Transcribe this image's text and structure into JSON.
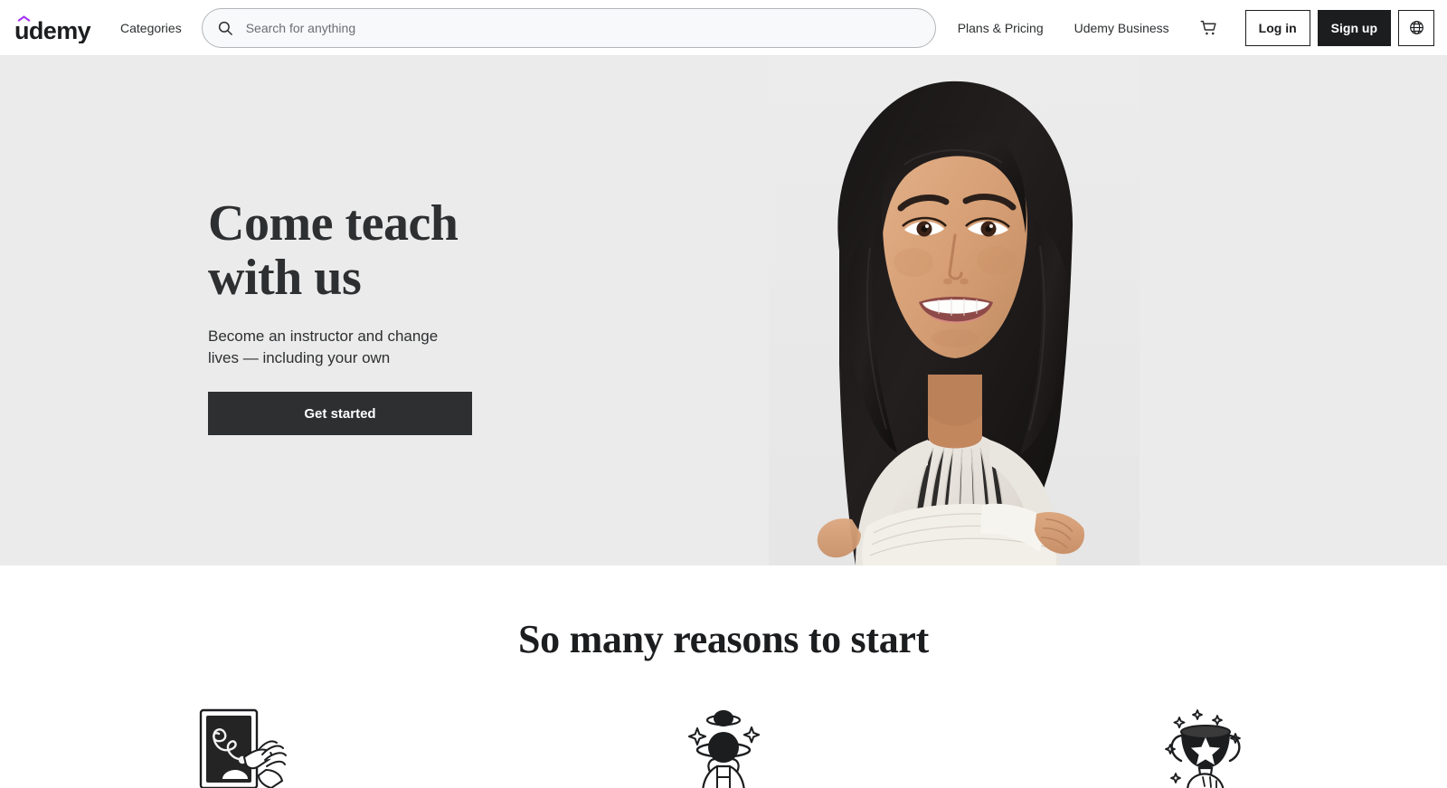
{
  "brand": {
    "logo_text": "udemy",
    "logo_accent_color": "#a435f0",
    "logo_text_color": "#1c1d1f"
  },
  "header": {
    "categories_label": "Categories",
    "search": {
      "placeholder": "Search for anything",
      "value": "",
      "icon": "search-icon"
    },
    "plans_pricing_label": "Plans & Pricing",
    "udemy_business_label": "Udemy Business",
    "cart_icon": "shopping-cart-icon",
    "login_label": "Log in",
    "signup_label": "Sign up",
    "language_icon": "globe-icon"
  },
  "hero": {
    "title_line1": "Come teach",
    "title_line2": "with us",
    "subtitle": "Become an instructor and change lives — including your own",
    "cta_label": "Get started",
    "background_color": "#ebebeb",
    "image_alt": "smiling-instructor-portrait"
  },
  "reasons": {
    "heading": "So many reasons to start",
    "items": [
      {
        "icon": "chalkboard-drawing-hand-icon"
      },
      {
        "icon": "person-with-planet-head-icon"
      },
      {
        "icon": "trophy-with-star-icon"
      }
    ]
  },
  "colors": {
    "accent_purple": "#a435f0",
    "dark": "#1c1d1f",
    "button_dark": "#2d2f31",
    "hero_gray": "#ebebeb",
    "muted_text": "#6a6f73"
  }
}
